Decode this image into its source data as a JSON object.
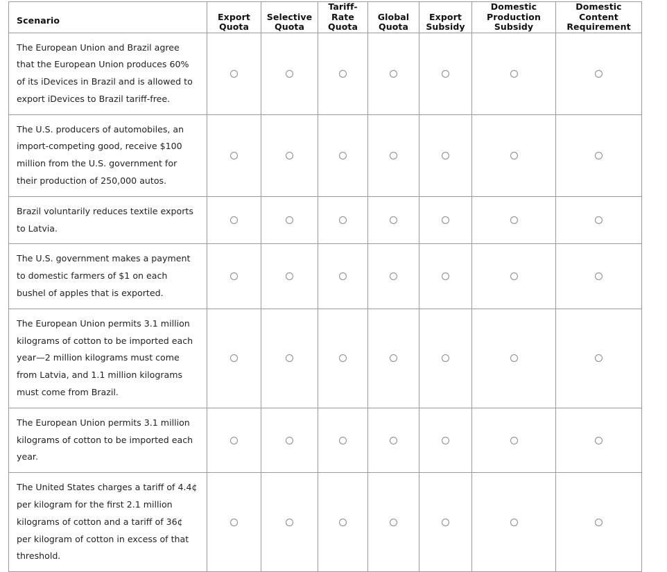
{
  "table": {
    "columns": [
      {
        "id": "scenario",
        "label": "Scenario"
      },
      {
        "id": "export_quota",
        "label": "Export\nQuota"
      },
      {
        "id": "selective_quota",
        "label": "Selective\nQuota"
      },
      {
        "id": "tariff_rate_quota",
        "label": "Tariff-\nRate\nQuota"
      },
      {
        "id": "global_quota",
        "label": "Global\nQuota"
      },
      {
        "id": "export_subsidy",
        "label": "Export\nSubsidy"
      },
      {
        "id": "domestic_production_subsidy",
        "label": "Domestic\nProduction\nSubsidy"
      },
      {
        "id": "domestic_content_requirement",
        "label": "Domestic\nContent\nRequirement"
      }
    ],
    "rows": [
      {
        "scenario": "The European Union and Brazil agree that the European Union produces 60% of its iDevices in Brazil and is allowed to export iDevices to Brazil tariff-free.",
        "selected": null
      },
      {
        "scenario": "The U.S. producers of automobiles, an import-competing good, receive $100 million from the U.S. government for their production of 250,000 autos.",
        "selected": null
      },
      {
        "scenario": "Brazil voluntarily reduces textile exports to Latvia.",
        "selected": null
      },
      {
        "scenario": "The U.S. government makes a payment to domestic farmers of $1 on each bushel of apples that is exported.",
        "selected": null
      },
      {
        "scenario": "The European Union permits 3.1 million kilograms of cotton to be imported each year—2 million kilograms must come from Latvia, and 1.1 million kilograms must come from Brazil.",
        "selected": null
      },
      {
        "scenario": "The European Union permits 3.1 million kilograms of cotton to be imported each year.",
        "selected": null
      },
      {
        "scenario": "The United States charges a tariff of 4.4¢ per kilogram for the first 2.1 million kilograms of cotton and a tariff of 36¢ per kilogram of cotton in excess of that threshold.",
        "selected": null
      }
    ]
  },
  "style": {
    "border_color": "#9a9a9a",
    "radio_border_color": "#8a8a8a",
    "text_color": "#222222",
    "background": "#ffffff"
  }
}
